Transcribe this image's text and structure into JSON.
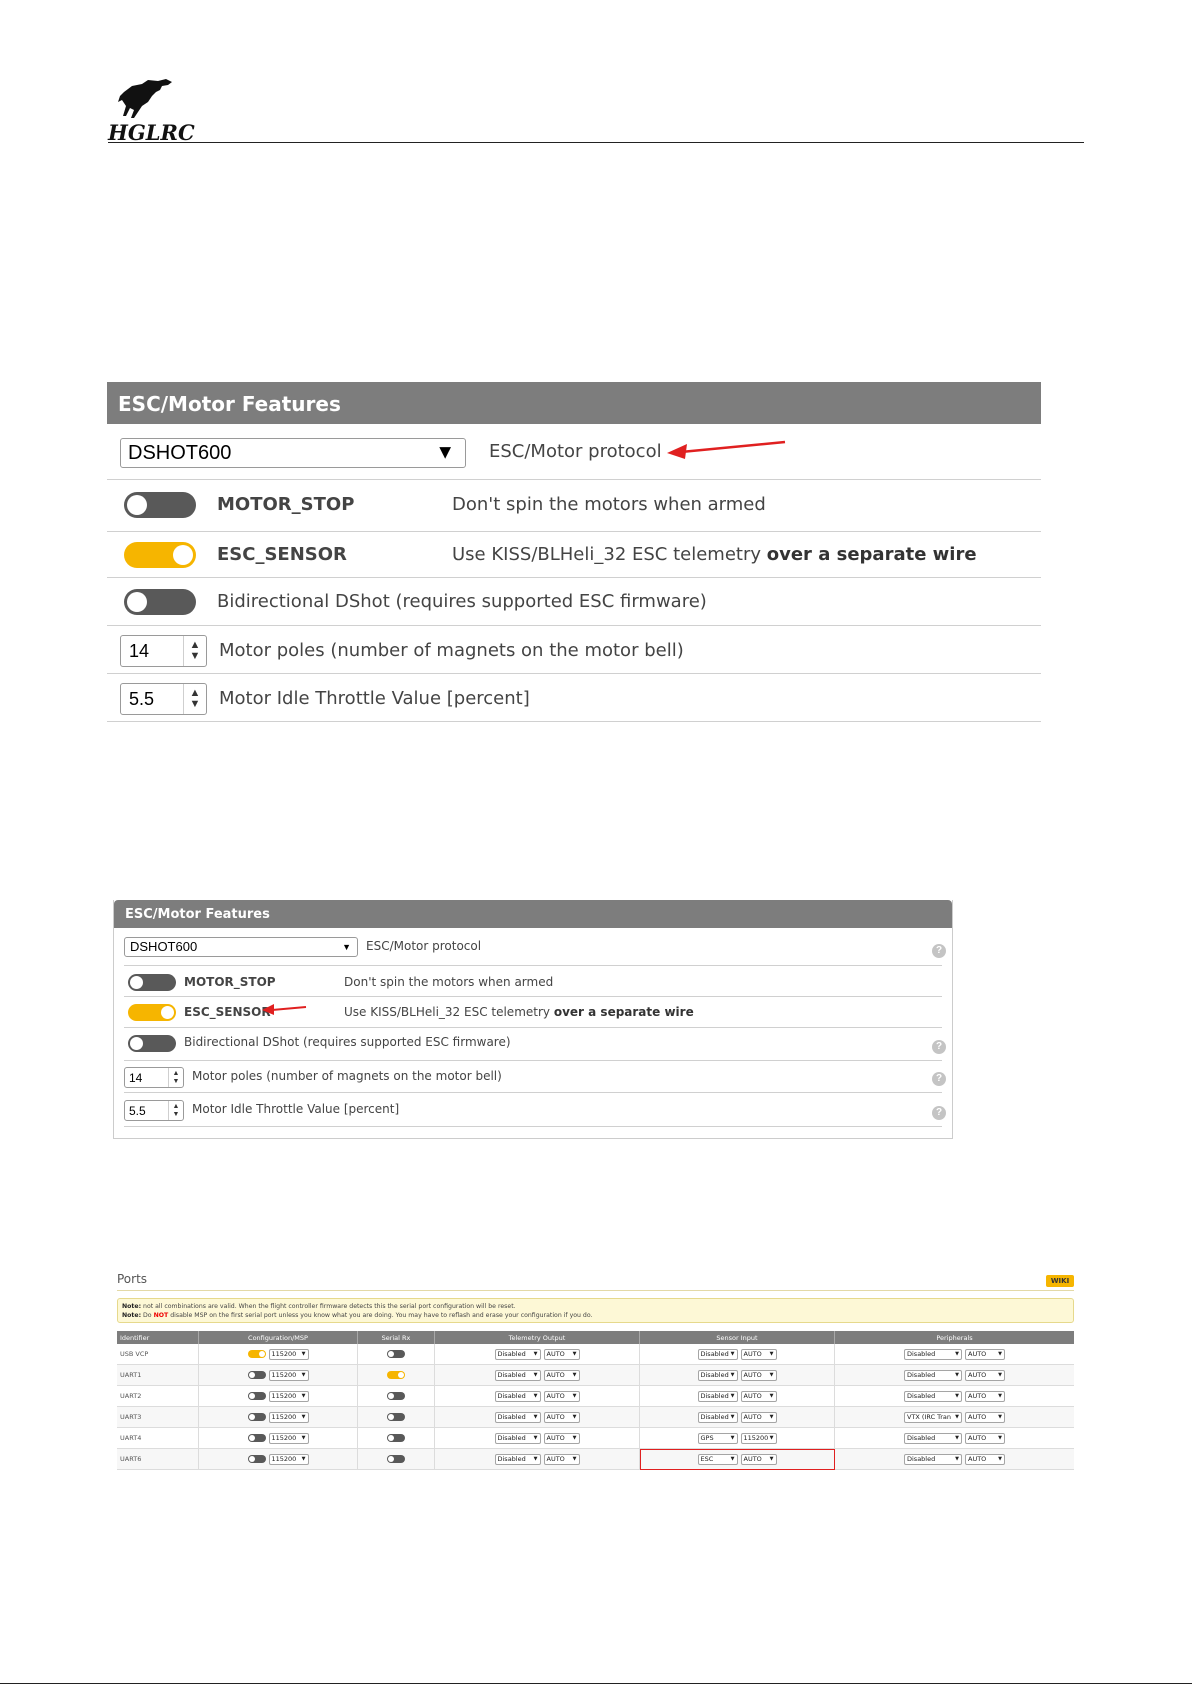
{
  "header": {
    "logo_text": "HGLRC"
  },
  "panel_large": {
    "title": "ESC/Motor Features",
    "protocol_value": "DSHOT600",
    "protocol_label": "ESC/Motor protocol",
    "motor_stop_name": "MOTOR_STOP",
    "motor_stop_desc": "Don't spin the motors when armed",
    "motor_stop_on": false,
    "esc_sensor_name": "ESC_SENSOR",
    "esc_sensor_desc": "Use KISS/BLHeli_32 ESC telemetry",
    "esc_sensor_desc_bold": "over a separate wire",
    "esc_sensor_on": true,
    "bidir_label": "Bidirectional DShot (requires supported ESC firmware)",
    "bidir_on": false,
    "poles_value": "14",
    "poles_label": "Motor poles (number of magnets on the motor bell)",
    "idle_value": "5.5",
    "idle_label": "Motor Idle Throttle Value [percent]"
  },
  "panel_small": {
    "title": "ESC/Motor Features",
    "protocol_value": "DSHOT600",
    "protocol_label": "ESC/Motor protocol",
    "motor_stop_name": "MOTOR_STOP",
    "motor_stop_desc": "Don't spin the motors when armed",
    "esc_sensor_name": "ESC_SENSOR",
    "esc_sensor_desc": "Use KISS/BLHeli_32 ESC telemetry",
    "esc_sensor_desc_bold": "over a separate wire",
    "bidir_label": "Bidirectional DShot (requires supported ESC firmware)",
    "poles_value": "14",
    "poles_label": "Motor poles (number of magnets on the motor bell)",
    "idle_value": "5.5",
    "idle_label": "Motor Idle Throttle Value [percent]",
    "help_glyph": "?"
  },
  "ports": {
    "title": "Ports",
    "wiki_label": "WIKI",
    "note1_prefix": "Note:",
    "note1_text": "not all combinations are valid. When the flight controller firmware detects this the serial port configuration will be reset.",
    "note2_prefix": "Note:",
    "note2_pre": "Do",
    "note2_not": "NOT",
    "note2_text": "disable MSP on the first serial port unless you know what you are doing. You may have to reflash and erase your configuration if you do.",
    "columns": [
      "Identifier",
      "Configuration/MSP",
      "Serial Rx",
      "Telemetry Output",
      "Sensor Input",
      "Peripherals"
    ],
    "rows": [
      {
        "id": "USB VCP",
        "msp_on": true,
        "msp_baud": "115200",
        "rx_on": false,
        "tel": "Disabled",
        "tel_baud": "AUTO",
        "sensor": "Disabled",
        "sensor_baud": "AUTO",
        "periph": "Disabled",
        "periph_baud": "AUTO"
      },
      {
        "id": "UART1",
        "msp_on": false,
        "msp_baud": "115200",
        "rx_on": true,
        "tel": "Disabled",
        "tel_baud": "AUTO",
        "sensor": "Disabled",
        "sensor_baud": "AUTO",
        "periph": "Disabled",
        "periph_baud": "AUTO"
      },
      {
        "id": "UART2",
        "msp_on": false,
        "msp_baud": "115200",
        "rx_on": false,
        "tel": "Disabled",
        "tel_baud": "AUTO",
        "sensor": "Disabled",
        "sensor_baud": "AUTO",
        "periph": "Disabled",
        "periph_baud": "AUTO"
      },
      {
        "id": "UART3",
        "msp_on": false,
        "msp_baud": "115200",
        "rx_on": false,
        "tel": "Disabled",
        "tel_baud": "AUTO",
        "sensor": "Disabled",
        "sensor_baud": "AUTO",
        "periph": "VTX (IRC Tran",
        "periph_baud": "AUTO"
      },
      {
        "id": "UART4",
        "msp_on": false,
        "msp_baud": "115200",
        "rx_on": false,
        "tel": "Disabled",
        "tel_baud": "AUTO",
        "sensor": "GPS",
        "sensor_baud": "115200",
        "periph": "Disabled",
        "periph_baud": "AUTO"
      },
      {
        "id": "UART6",
        "msp_on": false,
        "msp_baud": "115200",
        "rx_on": false,
        "tel": "Disabled",
        "tel_baud": "AUTO",
        "sensor": "ESC",
        "sensor_baud": "AUTO",
        "periph": "Disabled",
        "periph_baud": "AUTO"
      }
    ]
  },
  "colors": {
    "accent": "#f6b500",
    "header_gray": "#7d7d7d",
    "annotation_red": "#e02020"
  }
}
